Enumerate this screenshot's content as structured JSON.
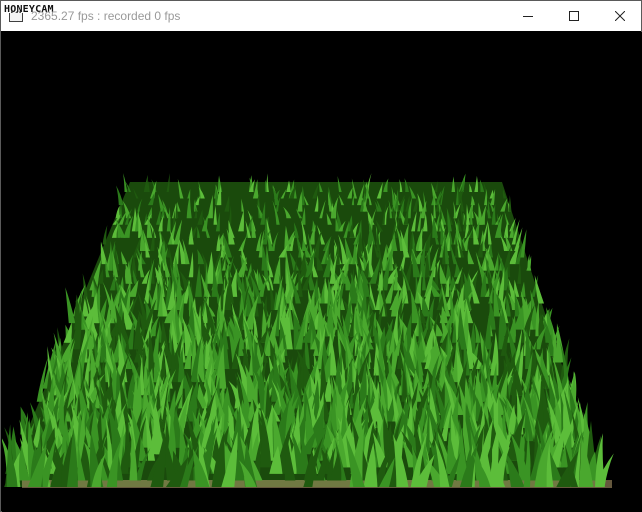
{
  "window": {
    "title": "2365.27 fps : recorded 0 fps",
    "watermark": "HONEYCAM"
  },
  "caption_buttons": {
    "minimize_icon": "minimize-icon",
    "maximize_icon": "maximize-icon",
    "close_icon": "close-icon"
  },
  "viewport": {
    "content": "3d-rendered-grass-field",
    "background_color": "#000000",
    "grass_colors": [
      "#1f5a0f",
      "#2b7a1a",
      "#3a9424",
      "#4aa82e",
      "#5cbd3a"
    ],
    "ground_color": "#b8a070"
  }
}
